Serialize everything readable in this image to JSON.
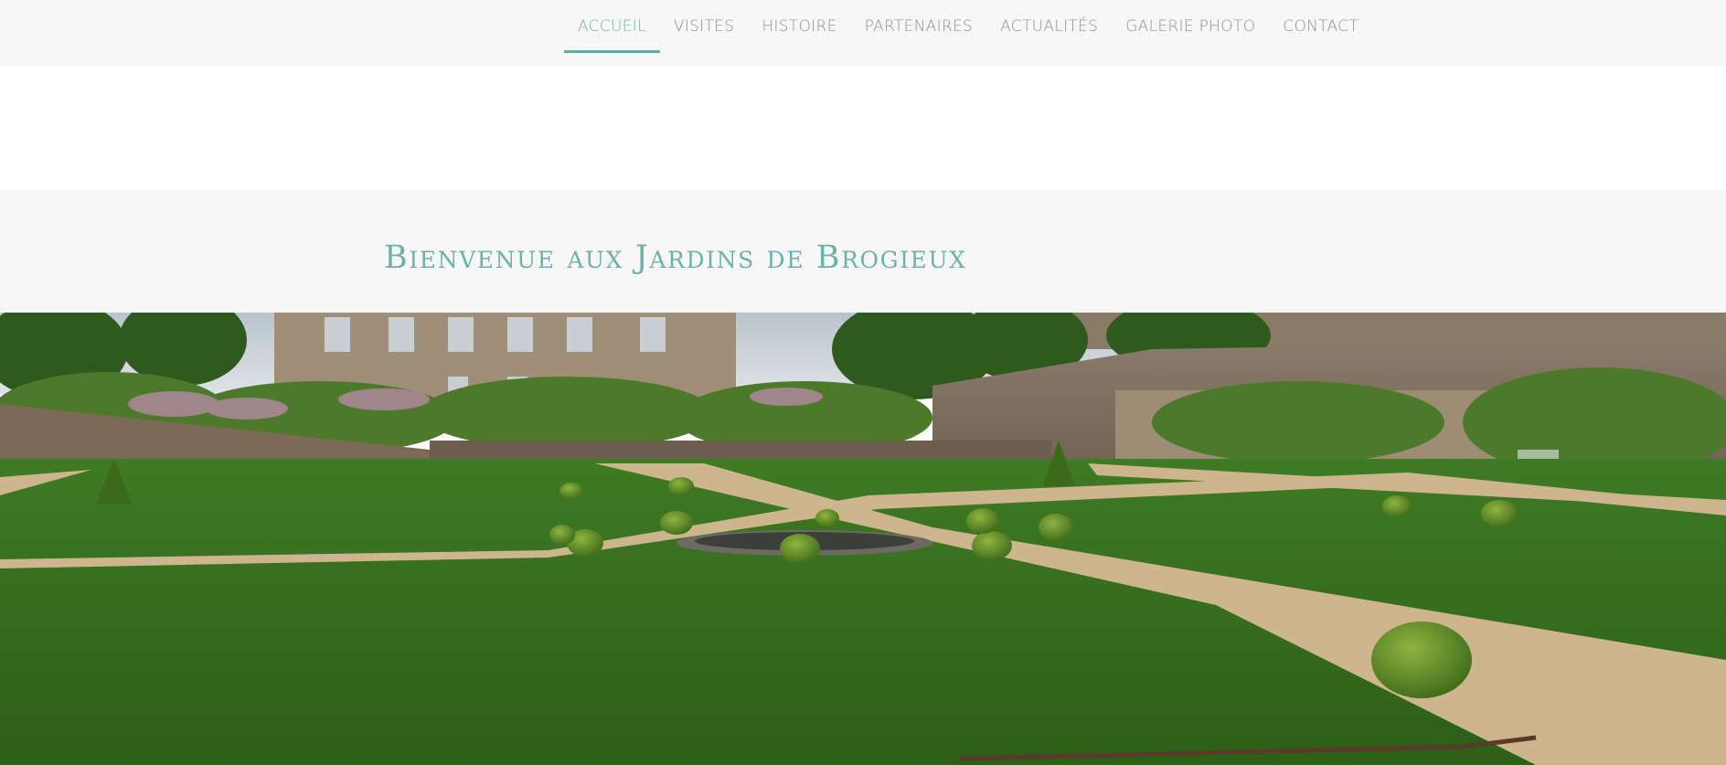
{
  "nav": {
    "items": [
      {
        "label": "ACCUEIL",
        "active": true
      },
      {
        "label": "VISITES",
        "active": false
      },
      {
        "label": "HISTOIRE",
        "active": false
      },
      {
        "label": "PARTENAIRES",
        "active": false
      },
      {
        "label": "ACTUALITÉS",
        "active": false
      },
      {
        "label": "GALERIE PHOTO",
        "active": false
      },
      {
        "label": "CONTACT",
        "active": false
      }
    ]
  },
  "header": {
    "title": "Bienvenue aux Jardins de Brogieux"
  },
  "colors": {
    "accent": "#5aaea1",
    "title": "#6db2a7",
    "nav_text": "#8b9492",
    "band_bg": "#f6f7f6"
  }
}
